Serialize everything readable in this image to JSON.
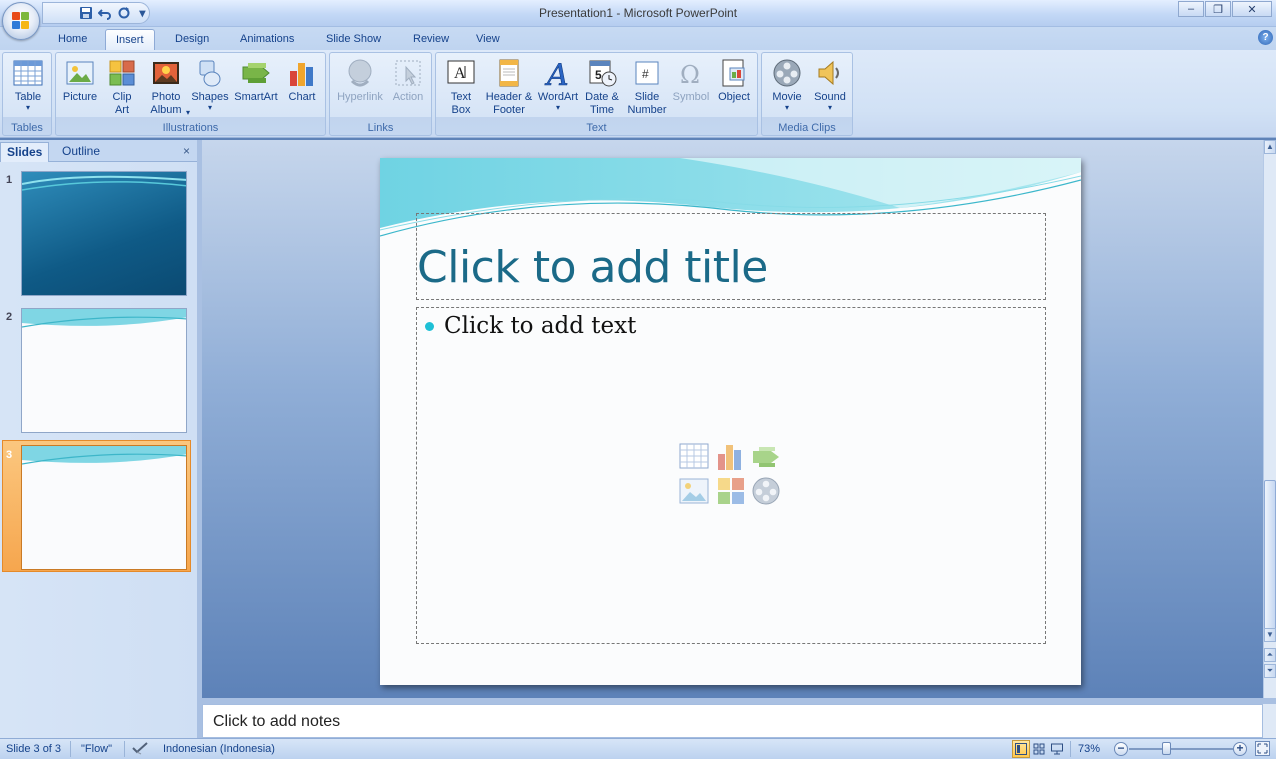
{
  "window": {
    "title": "Presentation1 - Microsoft PowerPoint",
    "controls": {
      "minimize": "–",
      "restore": "❐",
      "close": "✕"
    }
  },
  "qat": {
    "icons": [
      "save-icon",
      "undo-icon",
      "redo-icon",
      "customize-qat-icon"
    ],
    "dropdown": "▾"
  },
  "tabs": [
    "Home",
    "Insert",
    "Design",
    "Animations",
    "Slide Show",
    "Review",
    "View"
  ],
  "active_tab": "Insert",
  "help": "?",
  "ribbon": {
    "groups": {
      "tables": "Tables",
      "illustrations": "Illustrations",
      "links": "Links",
      "text": "Text",
      "media": "Media Clips"
    },
    "buttons": {
      "table": "Table",
      "picture": "Picture",
      "clipart": "Clip Art",
      "photoalbum": "Photo Album",
      "shapes": "Shapes",
      "smartart": "SmartArt",
      "chart": "Chart",
      "hyperlink": "Hyperlink",
      "action": "Action",
      "textbox": "Text Box",
      "headerfooter": "Header & Footer",
      "wordart": "WordArt",
      "datetime": "Date & Time",
      "slidenumber": "Slide Number",
      "symbol": "Symbol",
      "object": "Object",
      "movie": "Movie",
      "sound": "Sound"
    },
    "disabled": [
      "Hyperlink",
      "Action",
      "Symbol"
    ]
  },
  "left_pane": {
    "tab_slides": "Slides",
    "tab_outline": "Outline",
    "close": "×",
    "slides": [
      {
        "number": "1",
        "layout": "title-gradient"
      },
      {
        "number": "2",
        "layout": "content"
      },
      {
        "number": "3",
        "layout": "content",
        "selected": true
      }
    ]
  },
  "slide": {
    "title_placeholder": "Click to add title",
    "body_placeholder": "Click to add text",
    "content_icons": [
      "insert-table-icon",
      "insert-chart-icon",
      "insert-smartart-icon",
      "insert-picture-icon",
      "insert-clipart-icon",
      "insert-media-icon"
    ],
    "colors": {
      "title": "#1b6a88",
      "bullet": "#1ec0d6",
      "wave": "#5fd3e0"
    }
  },
  "notes": {
    "placeholder": "Click to add notes"
  },
  "status": {
    "slide_info": "Slide 3 of 3",
    "theme": "\"Flow\"",
    "language": "Indonesian (Indonesia)",
    "zoom": "73%",
    "zoom_minus": "−",
    "zoom_plus": "+"
  }
}
